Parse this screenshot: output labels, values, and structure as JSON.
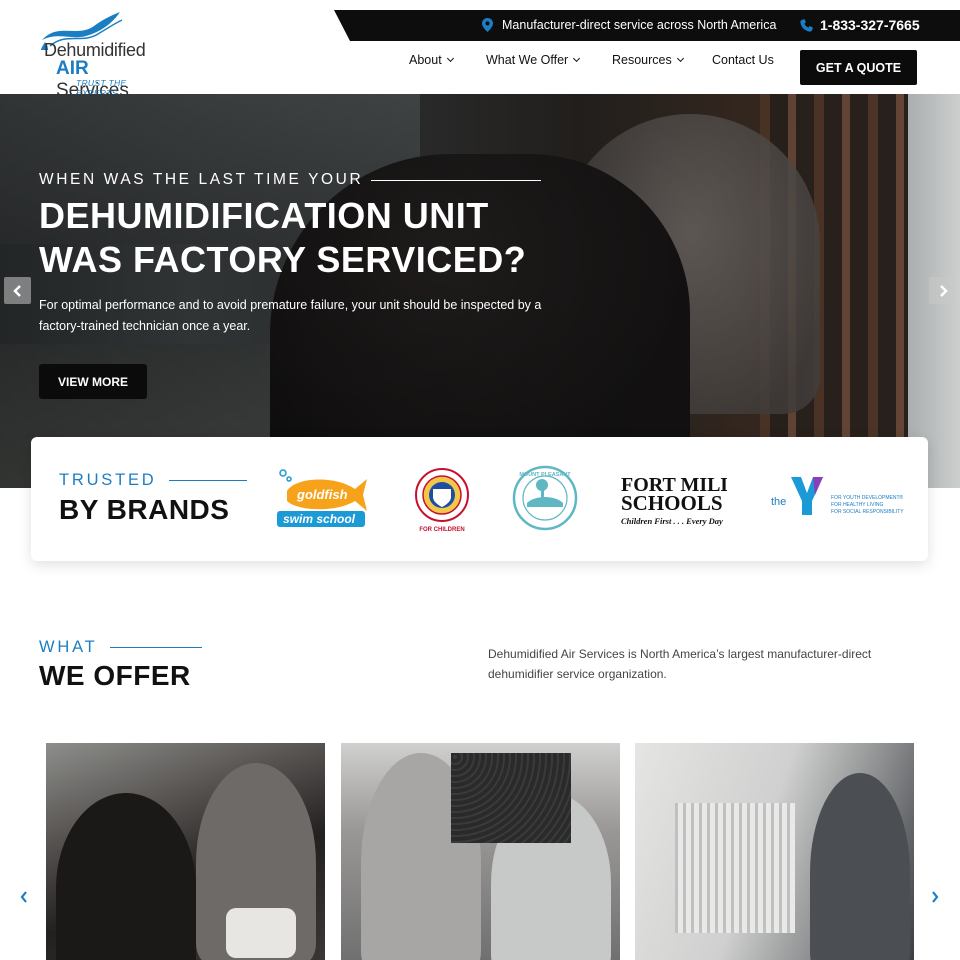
{
  "header": {
    "logo": {
      "line1": "Dehumidified",
      "line2_air": "AIR",
      "line2_rest": "Services",
      "tagline": "TRUST THE EXPERTS"
    },
    "topbar": {
      "service_text": "Manufacturer-direct service across North America",
      "phone": "1-833-327-7665"
    },
    "nav": [
      {
        "label": "About",
        "has_dropdown": true
      },
      {
        "label": "What We Offer",
        "has_dropdown": true
      },
      {
        "label": "Resources",
        "has_dropdown": true
      },
      {
        "label": "Contact Us",
        "has_dropdown": false
      }
    ],
    "cta": "GET A QUOTE"
  },
  "hero": {
    "pre_title": "WHEN WAS THE LAST TIME YOUR",
    "title_line1": "DEHUMIDIFICATION UNIT",
    "title_line2": "WAS FACTORY SERVICED?",
    "description": "For optimal performance and to avoid premature failure, your unit should be inspected by a factory-trained technician once a year.",
    "button": "VIEW MORE"
  },
  "brands": {
    "pre_title": "TRUSTED",
    "title": "BY BRANDS",
    "logos": [
      {
        "name": "goldfish-swim-school",
        "text1": "goldfish",
        "text2": "swim school"
      },
      {
        "name": "uisd-seal",
        "text1": "FOR CHILDREN"
      },
      {
        "name": "mount-pleasant-seal",
        "text1": "MOUNT PLEASANT"
      },
      {
        "name": "fort-mill-schools",
        "text1": "FORT MILL",
        "text2": "SCHOOLS",
        "text3": "Children First . . . Every Day"
      },
      {
        "name": "ymca",
        "text1": "the",
        "text2": "FOR YOUTH DEVELOPMENT®",
        "text3": "FOR HEALTHY LIVING",
        "text4": "FOR SOCIAL RESPONSIBILITY"
      }
    ]
  },
  "offer": {
    "pre_title": "WHAT",
    "title": "WE OFFER",
    "description": "Dehumidified Air Services is North America’s largest manufacturer-direct dehumidifier service organization."
  },
  "colors": {
    "accent": "#1c7ec2",
    "dark": "#0b0b0b",
    "white": "#ffffff"
  },
  "icons": {
    "location": "map-pin-icon",
    "phone": "phone-icon",
    "prev": "chevron-left-icon",
    "next": "chevron-right-icon"
  }
}
